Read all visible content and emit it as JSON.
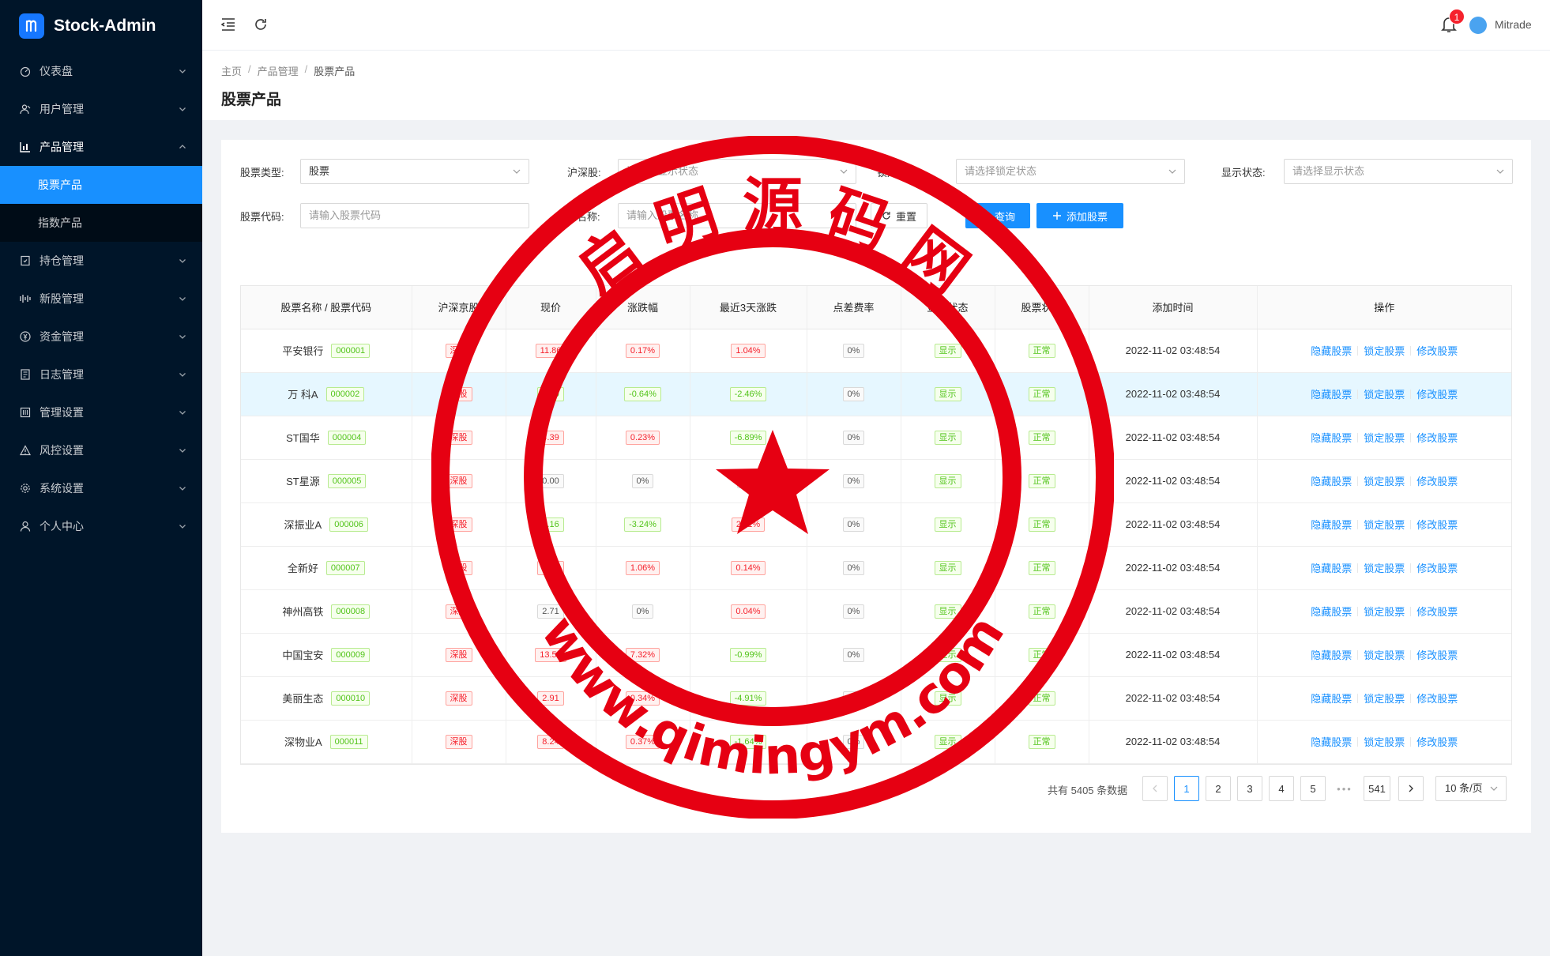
{
  "brand": {
    "title": "Stock-Admin"
  },
  "sidebar": {
    "items": [
      {
        "label": "仪表盘",
        "icon": "dashboard-icon"
      },
      {
        "label": "用户管理",
        "icon": "user-manage-icon"
      },
      {
        "label": "产品管理",
        "icon": "chart-icon",
        "open": true,
        "children": [
          {
            "label": "股票产品",
            "active": true
          },
          {
            "label": "指数产品"
          }
        ]
      },
      {
        "label": "持仓管理",
        "icon": "position-icon"
      },
      {
        "label": "新股管理",
        "icon": "new-stock-icon"
      },
      {
        "label": "资金管理",
        "icon": "money-icon"
      },
      {
        "label": "日志管理",
        "icon": "log-icon"
      },
      {
        "label": "管理设置",
        "icon": "admin-settings-icon"
      },
      {
        "label": "风控设置",
        "icon": "warning-icon"
      },
      {
        "label": "系统设置",
        "icon": "gear-icon"
      },
      {
        "label": "个人中心",
        "icon": "person-icon"
      }
    ]
  },
  "header": {
    "notification_count": "1",
    "username": "Mitrade"
  },
  "breadcrumb": [
    "主页",
    "产品管理",
    "股票产品"
  ],
  "page_title": "股票产品",
  "filters": {
    "stock_type_label": "股票类型:",
    "stock_type_value": "股票",
    "exchange_label": "沪深股:",
    "exchange_placeholder": "请选择显示状态",
    "lock_label": "锁定状态:",
    "lock_placeholder": "请选择锁定状态",
    "display_label": "显示状态:",
    "display_placeholder": "请选择显示状态",
    "code_label": "股票代码:",
    "code_placeholder": "请输入股票代码",
    "name_label": "股票名称:",
    "name_placeholder": "请输入股票名称",
    "reset_label": "重置",
    "search_label": "查询",
    "add_label": "添加股票"
  },
  "table": {
    "columns": [
      "股票名称 / 股票代码",
      "沪深京股",
      "现价",
      "涨跌幅",
      "最近3天涨跌",
      "点差费率",
      "显示状态",
      "股票状态",
      "添加时间",
      "操作"
    ],
    "actions": [
      "隐藏股票",
      "锁定股票",
      "修改股票"
    ],
    "rows": [
      {
        "name": "平安银行",
        "code": "000001",
        "market": "深股",
        "price": "11.86",
        "change": "0.17%",
        "change_color": "red",
        "change3": "1.04%",
        "change3_color": "red",
        "spread": "0%",
        "display": "显示",
        "status": "正常",
        "time": "2022-11-02 03:48:54"
      },
      {
        "name": "万 科A",
        "code": "000002",
        "market": "深股",
        "price": "6.20",
        "change": "-0.64%",
        "change_color": "green",
        "change3": "-2.46%",
        "change3_color": "green",
        "spread": "0%",
        "display": "显示",
        "status": "正常",
        "time": "2022-11-02 03:48:54",
        "highlight": true
      },
      {
        "name": "ST国华",
        "code": "000004",
        "market": "深股",
        "price": "4.39",
        "change": "0.23%",
        "change_color": "red",
        "change3": "-6.89%",
        "change3_color": "green",
        "spread": "0%",
        "display": "显示",
        "status": "正常",
        "time": "2022-11-02 03:48:54"
      },
      {
        "name": "ST星源",
        "code": "000005",
        "market": "深股",
        "price": "0.00",
        "change": "0%",
        "change_color": "gray",
        "change3": "0%",
        "change3_color": "gray",
        "spread": "0%",
        "display": "显示",
        "status": "正常",
        "time": "2022-11-02 03:48:54"
      },
      {
        "name": "深振业A",
        "code": "000006",
        "market": "深股",
        "price": "4.16",
        "change": "-3.24%",
        "change_color": "green",
        "change3": "2.11%",
        "change3_color": "red",
        "spread": "0%",
        "display": "显示",
        "status": "正常",
        "time": "2022-11-02 03:48:54"
      },
      {
        "name": "全新好",
        "code": "000007",
        "market": "深股",
        "price": "7.64",
        "change": "1.06%",
        "change_color": "red",
        "change3": "0.14%",
        "change3_color": "red",
        "spread": "0%",
        "display": "显示",
        "status": "正常",
        "time": "2022-11-02 03:48:54"
      },
      {
        "name": "神州高铁",
        "code": "000008",
        "market": "深股",
        "price": "2.71",
        "change": "0%",
        "change_color": "gray",
        "change3": "0.04%",
        "change3_color": "red",
        "spread": "0%",
        "display": "显示",
        "status": "正常",
        "time": "2022-11-02 03:48:54"
      },
      {
        "name": "中国宝安",
        "code": "000009",
        "market": "深股",
        "price": "13.50",
        "change": "7.32%",
        "change_color": "red",
        "change3": "-0.99%",
        "change3_color": "green",
        "spread": "0%",
        "display": "显示",
        "status": "正常",
        "time": "2022-11-02 03:48:54"
      },
      {
        "name": "美丽生态",
        "code": "000010",
        "market": "深股",
        "price": "2.91",
        "change": "0.34%",
        "change_color": "red",
        "change3": "-4.91%",
        "change3_color": "green",
        "spread": "0%",
        "display": "显示",
        "status": "正常",
        "time": "2022-11-02 03:48:54"
      },
      {
        "name": "深物业A",
        "code": "000011",
        "market": "深股",
        "price": "8.24",
        "change": "0.37%",
        "change_color": "red",
        "change3": "-1.64%",
        "change3_color": "green",
        "spread": "0%",
        "display": "显示",
        "status": "正常",
        "time": "2022-11-02 03:48:54"
      }
    ]
  },
  "pagination": {
    "total_text": "共有 5405 条数据",
    "pages": [
      "1",
      "2",
      "3",
      "4",
      "5"
    ],
    "ellipsis": "•••",
    "last_page": "541",
    "page_size": "10 条/页",
    "current": "1"
  },
  "watermark": {
    "top_text": "启 明 源 码 网",
    "bottom_text": "www.qimingym.com",
    "color": "#e60012"
  },
  "colors": {
    "sidebar_bg": "#001529",
    "primary": "#1890ff",
    "danger": "#f5222d",
    "success": "#52c41a"
  }
}
